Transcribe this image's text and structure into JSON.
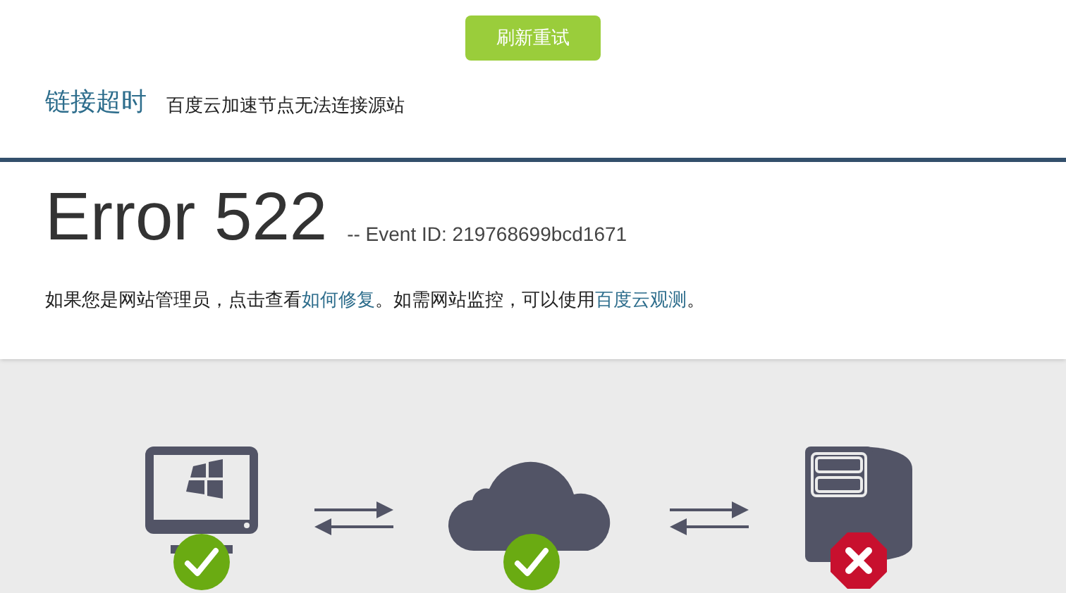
{
  "retry_button": "刷新重试",
  "error_title": "链接超时",
  "error_subtitle": "百度云加速节点无法连接源站",
  "error_code": "Error 522",
  "event_id": "-- Event ID: 219768699bcd1671",
  "message": [
    {
      "kind": "text",
      "text": "如果您是网站管理员，点击查看"
    },
    {
      "kind": "link",
      "text": "如何修复"
    },
    {
      "kind": "text",
      "text": "。如需网站监控，可以使用"
    },
    {
      "kind": "link",
      "text": "百度云观测"
    },
    {
      "kind": "text",
      "text": "。"
    }
  ],
  "nodes": [
    {
      "kind": "computer",
      "ok": true
    },
    {
      "kind": "cloud",
      "ok": true
    },
    {
      "kind": "server",
      "ok": false
    }
  ]
}
